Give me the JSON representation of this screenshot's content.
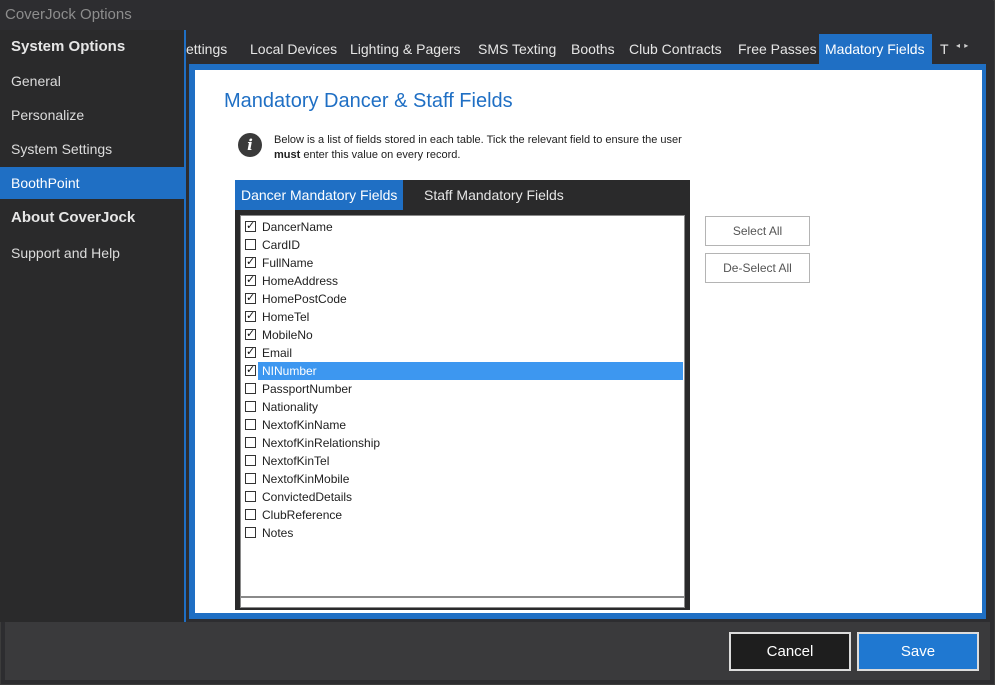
{
  "window": {
    "title": "CoverJock Options"
  },
  "sidebar": {
    "items": [
      {
        "label": "System Options",
        "type": "header"
      },
      {
        "label": "General"
      },
      {
        "label": "Personalize"
      },
      {
        "label": "System Settings"
      },
      {
        "label": "BoothPoint",
        "active": true
      },
      {
        "label": "About CoverJock",
        "type": "header"
      },
      {
        "label": "Support and Help"
      }
    ]
  },
  "tabs": {
    "items": [
      {
        "label": "ettings"
      },
      {
        "label": "Local Devices"
      },
      {
        "label": "Lighting & Pagers"
      },
      {
        "label": "SMS Texting"
      },
      {
        "label": "Booths"
      },
      {
        "label": "Club Contracts"
      },
      {
        "label": "Free Passes"
      },
      {
        "label": "Madatory Fields",
        "active": true
      },
      {
        "label": "T"
      }
    ],
    "arrows": "◂ ▸"
  },
  "page": {
    "title": "Mandatory Dancer & Staff Fields",
    "info_icon": "info-icon",
    "info_text_part1": "Below is a list of fields stored in each table. Tick the relevant field to ensure the user ",
    "info_text_bold": "must",
    "info_text_part2": " enter this value on every record."
  },
  "field_tabs": {
    "items": [
      {
        "label": "Dancer Mandatory Fields",
        "active": true
      },
      {
        "label": "Staff Mandatory Fields"
      }
    ]
  },
  "fields": [
    {
      "name": "DancerName",
      "checked": true
    },
    {
      "name": "CardID",
      "checked": false
    },
    {
      "name": "FullName",
      "checked": true
    },
    {
      "name": "HomeAddress",
      "checked": true
    },
    {
      "name": "HomePostCode",
      "checked": true
    },
    {
      "name": "HomeTel",
      "checked": true
    },
    {
      "name": "MobileNo",
      "checked": true
    },
    {
      "name": "Email",
      "checked": true
    },
    {
      "name": "NINumber",
      "checked": true,
      "selected": true
    },
    {
      "name": "PassportNumber",
      "checked": false
    },
    {
      "name": "Nationality",
      "checked": false
    },
    {
      "name": "NextofKinName",
      "checked": false
    },
    {
      "name": "NextofKinRelationship",
      "checked": false
    },
    {
      "name": "NextofKinTel",
      "checked": false
    },
    {
      "name": "NextofKinMobile",
      "checked": false
    },
    {
      "name": "ConvictedDetails",
      "checked": false
    },
    {
      "name": "ClubReference",
      "checked": false
    },
    {
      "name": "Notes",
      "checked": false
    }
  ],
  "actions": {
    "select_all": "Select All",
    "deselect_all": "De-Select All"
  },
  "footer": {
    "cancel": "Cancel",
    "save": "Save"
  },
  "colors": {
    "accent": "#1f6fc4",
    "selection": "#3d97f0",
    "background": "#2d2d30"
  }
}
